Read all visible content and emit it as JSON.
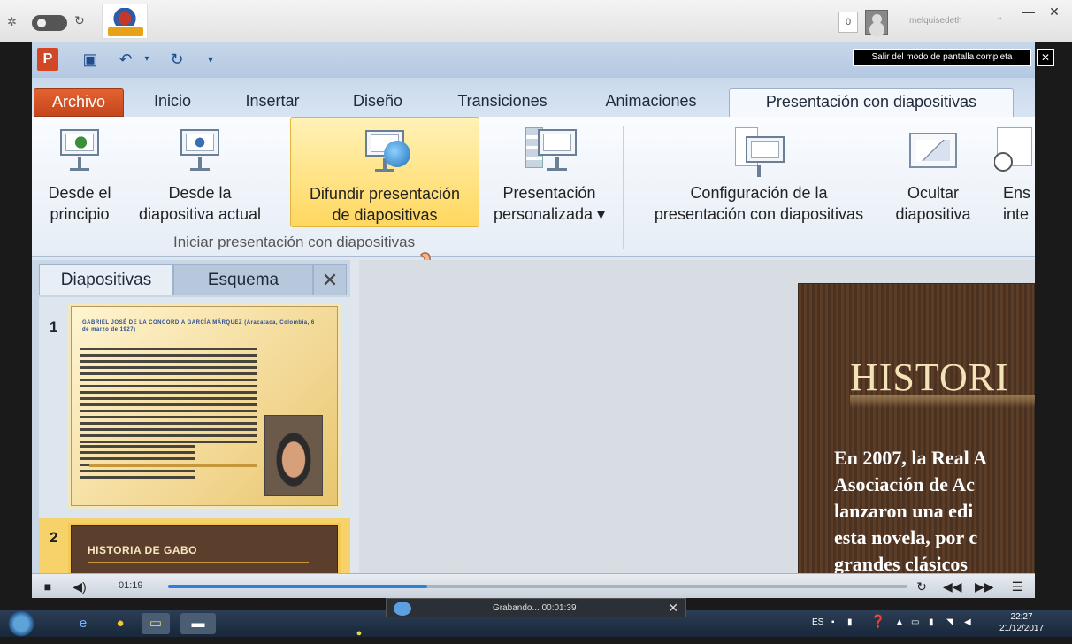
{
  "browser": {
    "counter": "0",
    "username": "melquisedeth",
    "minimize": "—",
    "close": "✕"
  },
  "overlay": {
    "exit_fullscreen": "Salir del modo de pantalla completa",
    "exit_close": "✕"
  },
  "ppt": {
    "logo_letter": "P",
    "tabs": [
      "Archivo",
      "Inicio",
      "Insertar",
      "Diseño",
      "Transiciones",
      "Animaciones",
      "Presentación con diapositivas"
    ],
    "ribbon": {
      "btn_desde_principio": "Desde el\nprincipio",
      "btn_desde_actual": "Desde la\ndiapositiva actual",
      "btn_difundir": "Difundir presentación\nde diapositivas",
      "btn_personalizada": "Presentación\npersonalizada ▾",
      "btn_configuracion": "Configuración de la\npresentación con diapositivas",
      "btn_ocultar": "Ocultar\ndiapositiva",
      "btn_ensayar": "Ens\ninte",
      "group_label": "Iniciar presentación con diapositivas"
    },
    "panel": {
      "tab_slides": "Diapositivas",
      "tab_outline": "Esquema",
      "close": "✕",
      "slide1_num": "1",
      "slide1_title": "GABRIEL JOSÉ DE LA CONCORDIA GARCÍA MÁRQUEZ (Aracataca, Colombia, 6 de marzo de 1927)",
      "slide2_num": "2",
      "slide2_title": "HISTORIA DE GABO"
    },
    "slide": {
      "title": "HISTORI",
      "body_lines": [
        "En 2007, la Real A",
        "Asociación de Ac",
        "lanzaron una edi",
        "esta novela, por c",
        "grandes clásicos"
      ]
    }
  },
  "player": {
    "time": "01:19",
    "progress_fraction": 0.35
  },
  "taskbar": {
    "recording_label": "Grabando...  00:01:39",
    "recording_close": "✕",
    "lang": "ES",
    "time": "22:27",
    "date": "21/12/2017"
  }
}
